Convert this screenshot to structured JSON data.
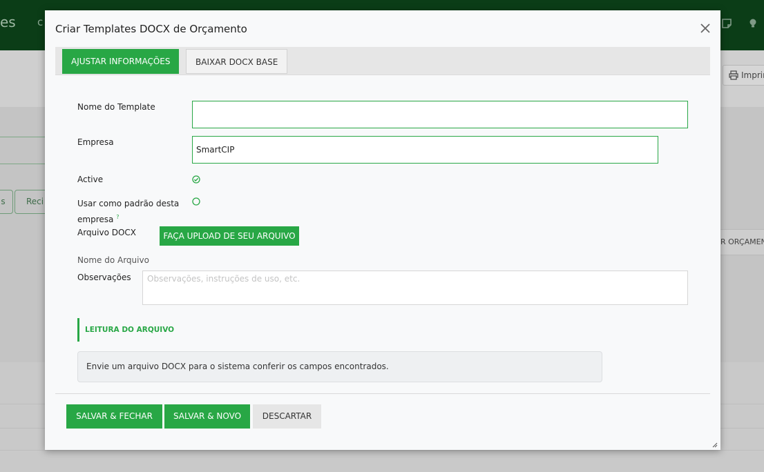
{
  "background": {
    "brand_fragment": "es",
    "brand_c": "c",
    "print_label": "Imprimir",
    "button_fragment_1": "s",
    "button_fragment_2": "Reci",
    "orcamento_label": "R ORÇAMENTO"
  },
  "modal": {
    "title": "Criar Templates DOCX de Orçamento",
    "close_icon": "close-icon",
    "tabs": [
      {
        "label": "AJUSTAR INFORMAÇÕES",
        "active": true
      },
      {
        "label": "BAIXAR DOCX BASE",
        "active": false
      }
    ],
    "form": {
      "template_name_label": "Nome do Template",
      "template_name_value": "",
      "empresa_label": "Empresa",
      "empresa_value": "SmartCIP",
      "active_label": "Active",
      "active_checked": true,
      "default_label": "Usar como padrão desta empresa",
      "default_help": "?",
      "default_checked": false,
      "docx_label": "Arquivo DOCX",
      "upload_label": "FAÇA UPLOAD DE SEU ARQUIVO",
      "filename_label": "Nome do Arquivo",
      "notes_label": "Observações",
      "notes_placeholder": "Observações, instruções de uso, etc."
    },
    "reading_section": {
      "title": "LEITURA DO ARQUIVO",
      "message": "Envie um arquivo DOCX para o sistema conferir os campos encontrados."
    },
    "footer": {
      "save_close": "SALVAR & FECHAR",
      "save_new": "SALVAR & NOVO",
      "discard": "DESCARTAR"
    }
  },
  "colors": {
    "primary_green": "#28a745",
    "topbar_dark": "#0b3d17"
  }
}
